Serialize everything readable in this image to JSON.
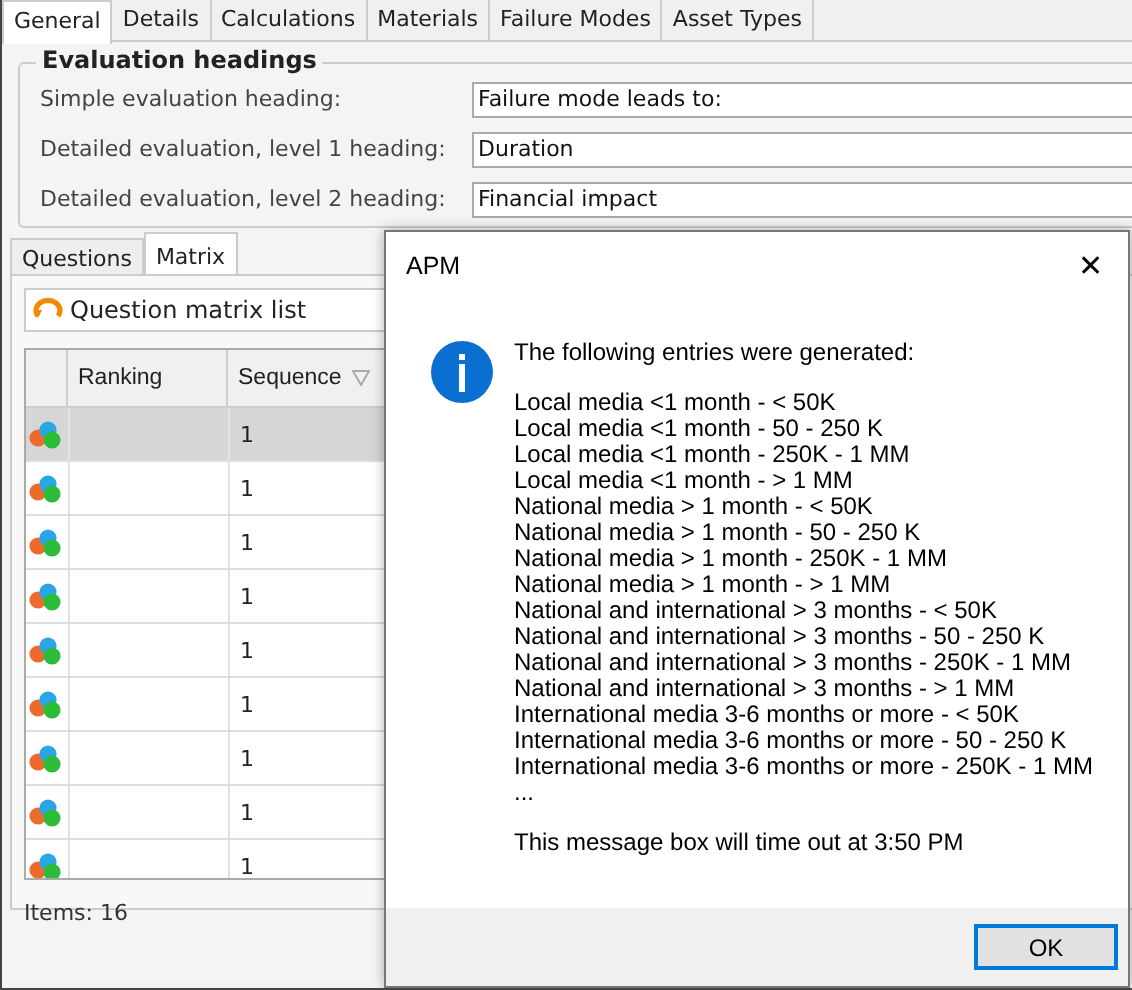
{
  "tabs": [
    {
      "label": "General",
      "selected": true
    },
    {
      "label": "Details",
      "selected": false
    },
    {
      "label": "Calculations",
      "selected": false
    },
    {
      "label": "Materials",
      "selected": false
    },
    {
      "label": "Failure Modes",
      "selected": false
    },
    {
      "label": "Asset Types",
      "selected": false
    }
  ],
  "group": {
    "title": "Evaluation headings",
    "fields": [
      {
        "label": "Simple evaluation  heading:",
        "value": "Failure mode leads to:"
      },
      {
        "label": "Detailed evaluation, level 1 heading:",
        "value": "Duration"
      },
      {
        "label": "Detailed evaluation, level 2 heading:",
        "value": "Financial impact"
      }
    ]
  },
  "subtabs": [
    {
      "label": "Questions",
      "selected": false
    },
    {
      "label": "Matrix",
      "selected": true
    }
  ],
  "matrix": {
    "toolbar_label": "Question matrix list",
    "columns": [
      "Ranking",
      "Sequence"
    ],
    "rows": [
      {
        "sequence": "1",
        "selected": true
      },
      {
        "sequence": "1",
        "selected": false
      },
      {
        "sequence": "1",
        "selected": false
      },
      {
        "sequence": "1",
        "selected": false
      },
      {
        "sequence": "1",
        "selected": false
      },
      {
        "sequence": "1",
        "selected": false
      },
      {
        "sequence": "1",
        "selected": false
      },
      {
        "sequence": "1",
        "selected": false
      },
      {
        "sequence": "1",
        "selected": false
      }
    ]
  },
  "status": "Items: 16",
  "dialog": {
    "title": "APM",
    "close": "✕",
    "heading": "The following entries were generated:",
    "entries": [
      "Local media <1 month - < 50K",
      "Local media <1 month - 50 - 250 K",
      "Local media <1 month - 250K - 1 MM",
      "Local media <1 month - > 1 MM",
      "National media > 1 month - < 50K",
      "National media > 1 month - 50 - 250 K",
      "National media > 1 month - 250K - 1 MM",
      "National media > 1 month - > 1 MM",
      "National and international > 3 months - < 50K",
      "National and international > 3 months - 50 - 250 K",
      "National and international > 3 months - 250K - 1 MM",
      "National and international > 3 months - > 1 MM",
      "International media 3-6 months or more - < 50K",
      "International media 3-6 months or more - 50 - 250 K",
      "International media 3-6 months or more - 250K - 1 MM",
      "..."
    ],
    "timeout": "This message box will time out at 3:50 PM",
    "buttons": [
      {
        "label": "OK",
        "focused": true
      }
    ]
  }
}
